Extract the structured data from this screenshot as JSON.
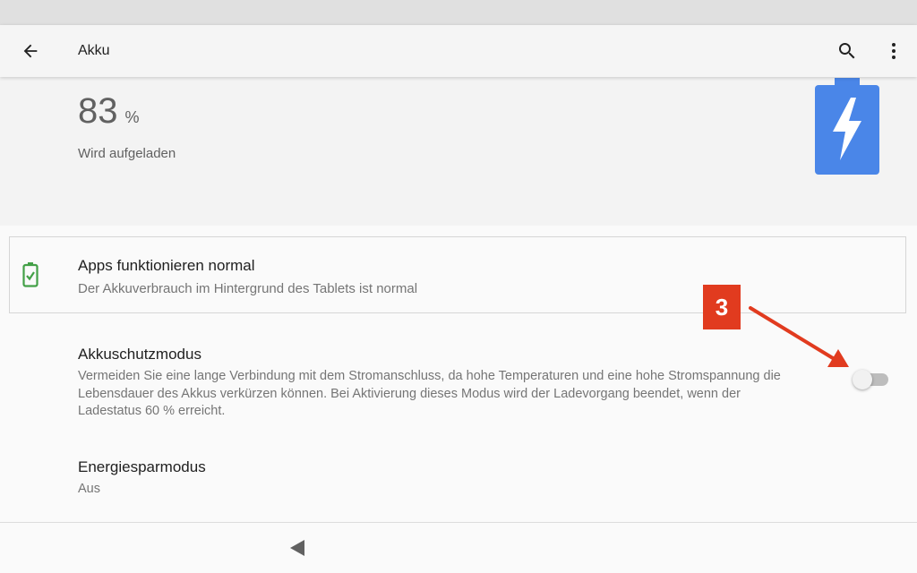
{
  "appbar": {
    "title": "Akku",
    "back_icon": "arrow-left-icon",
    "search_icon": "search-icon",
    "more_icon": "more-vert-icon"
  },
  "battery": {
    "percent": "83",
    "unit": "%",
    "status": "Wird aufgeladen",
    "icon": "battery-charging-icon",
    "icon_color": "#4a86e8"
  },
  "status_card": {
    "title": "Apps funktionieren normal",
    "subtitle": "Der Akkuverbrauch im Hintergrund des Tablets ist normal",
    "icon": "battery-check-icon",
    "icon_color": "#43a047"
  },
  "settings": [
    {
      "title": "Akkuschutzmodus",
      "subtitle": "Vermeiden Sie eine lange Verbindung mit dem Stromanschluss, da hohe Temperaturen und eine hohe Stromspannung die Lebensdauer des Akkus verkürzen können. Bei Aktivierung dieses Modus wird der Ladevorgang beendet, wenn der Ladestatus 60 % erreicht.",
      "toggle": false
    },
    {
      "title": "Energiesparmodus",
      "subtitle": "Aus"
    }
  ],
  "annotation": {
    "label": "3",
    "color": "#e13b1f"
  },
  "navbar": {
    "back_icon": "nav-back-triangle-icon"
  }
}
